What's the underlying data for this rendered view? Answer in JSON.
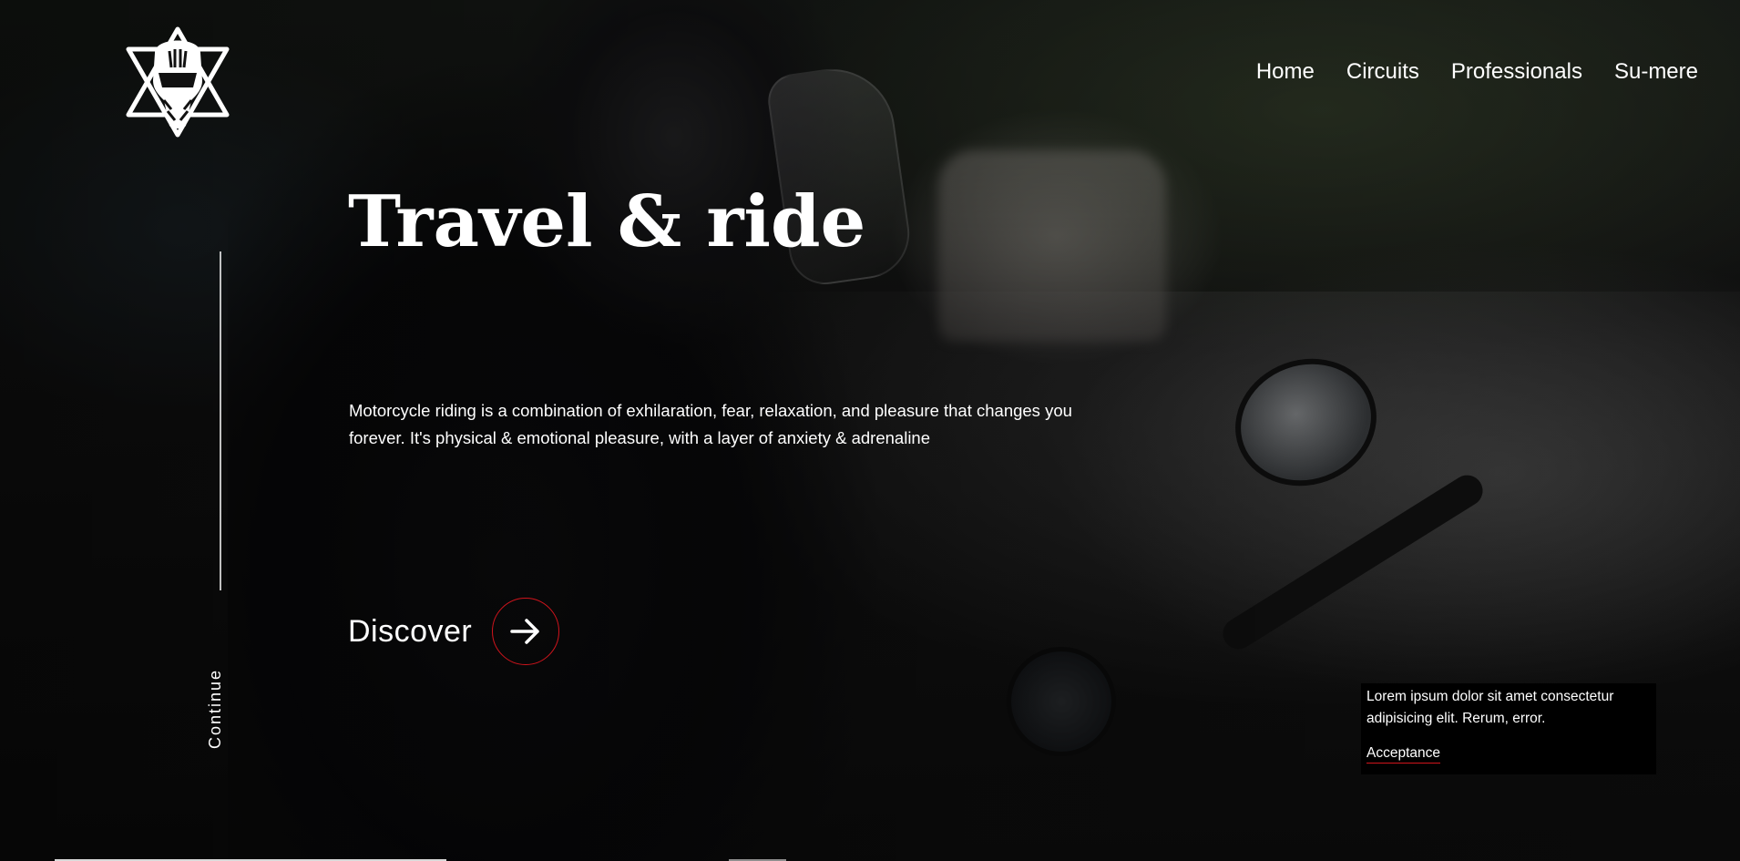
{
  "nav": {
    "items": [
      {
        "label": "Home"
      },
      {
        "label": "Circuits"
      },
      {
        "label": "Professionals"
      },
      {
        "label": "Su-mere"
      }
    ]
  },
  "hero": {
    "title": "Travel & ride",
    "description": "Motorcycle riding is a combination of exhilaration, fear, relaxation, and pleasure that changes you forever. It's physical & emotional pleasure, with a layer of anxiety & adrenaline",
    "cta_label": "Discover",
    "cta_icon": "arrow-right-icon"
  },
  "side": {
    "continue_label": "Continue"
  },
  "cookie": {
    "text": "Lorem ipsum dolor sit amet consectetur adipisicing elit. Rerum, error.",
    "accept_label": "Acceptance"
  },
  "colors": {
    "accent": "#d0141c",
    "text": "#ffffff",
    "cookie_bg": "#000000"
  }
}
